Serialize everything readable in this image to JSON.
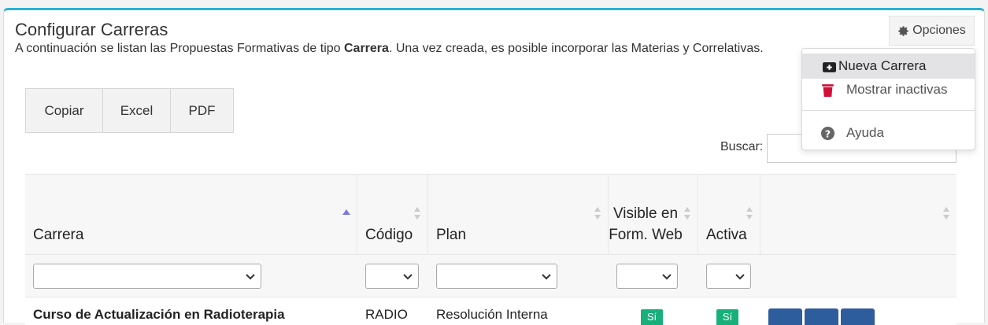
{
  "page": {
    "title": "Configurar Carreras",
    "subtitle_before": "A continuación se listan las Propuestas Formativas de tipo ",
    "subtitle_bold": "Carrera",
    "subtitle_after": ". Una vez creada, es posible incorporar las Materias y Correlativas."
  },
  "options_button": {
    "label": "Opciones",
    "icon": "gear-icon"
  },
  "dropdown": {
    "items": [
      {
        "label": "Nueva Carrera",
        "icon": "plus-square-icon",
        "active": true
      },
      {
        "label": "Mostrar inactivas",
        "icon": "trash-icon",
        "active": false
      },
      {
        "label": "Ayuda",
        "icon": "question-circle-icon",
        "active": false
      }
    ]
  },
  "export_buttons": [
    "Copiar",
    "Excel",
    "PDF"
  ],
  "search": {
    "label": "Buscar:",
    "value": ""
  },
  "table": {
    "columns": [
      "Carrera",
      "Código",
      "Plan",
      "Visible en Form. Web",
      "Activa",
      ""
    ],
    "rows": [
      {
        "carrera": "Curso de Actualización en Radioterapia",
        "codigo": "RADIO",
        "plan": "Resolución Interna",
        "visible": "Sí",
        "activa": "Sí"
      }
    ]
  },
  "colors": {
    "accent_top_border": "#27b1d8",
    "badge_green": "#17b07b",
    "action_blue": "#2e5d9e",
    "trash_red": "#d0103a"
  }
}
